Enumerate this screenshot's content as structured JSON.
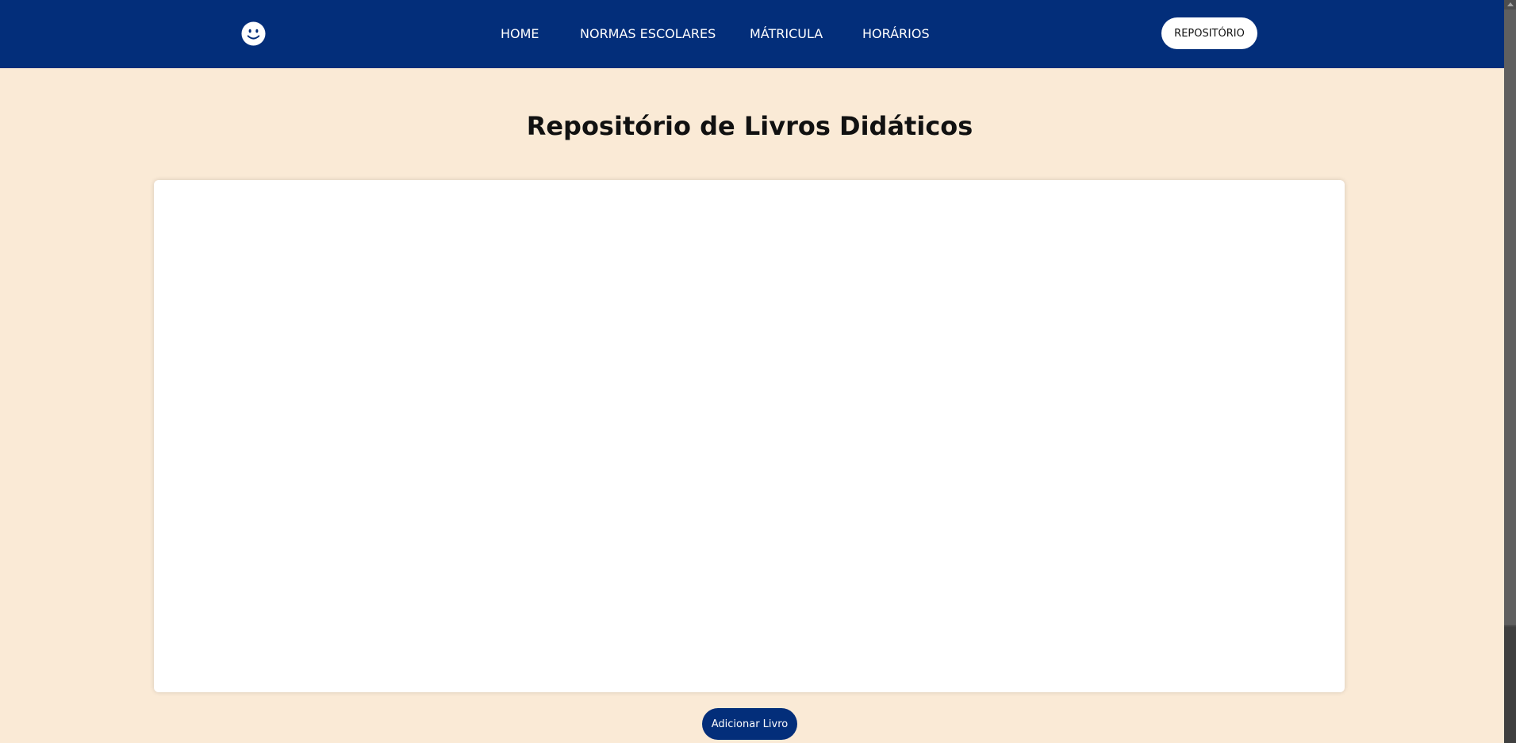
{
  "header": {
    "logo_icon": "smiley-face-icon",
    "nav": {
      "home": "HOME",
      "normas": "NORMAS ESCOLARES",
      "matricula": "MÁTRICULA",
      "horarios": "HORÁRIOS"
    },
    "repo_button": "REPOSITÓRIO"
  },
  "main": {
    "title": "Repositório de Livros Didáticos",
    "add_button": "Adicionar Livro"
  },
  "colors": {
    "navbar": "#032e7a",
    "background": "#faead6",
    "panel": "#ffffff"
  }
}
